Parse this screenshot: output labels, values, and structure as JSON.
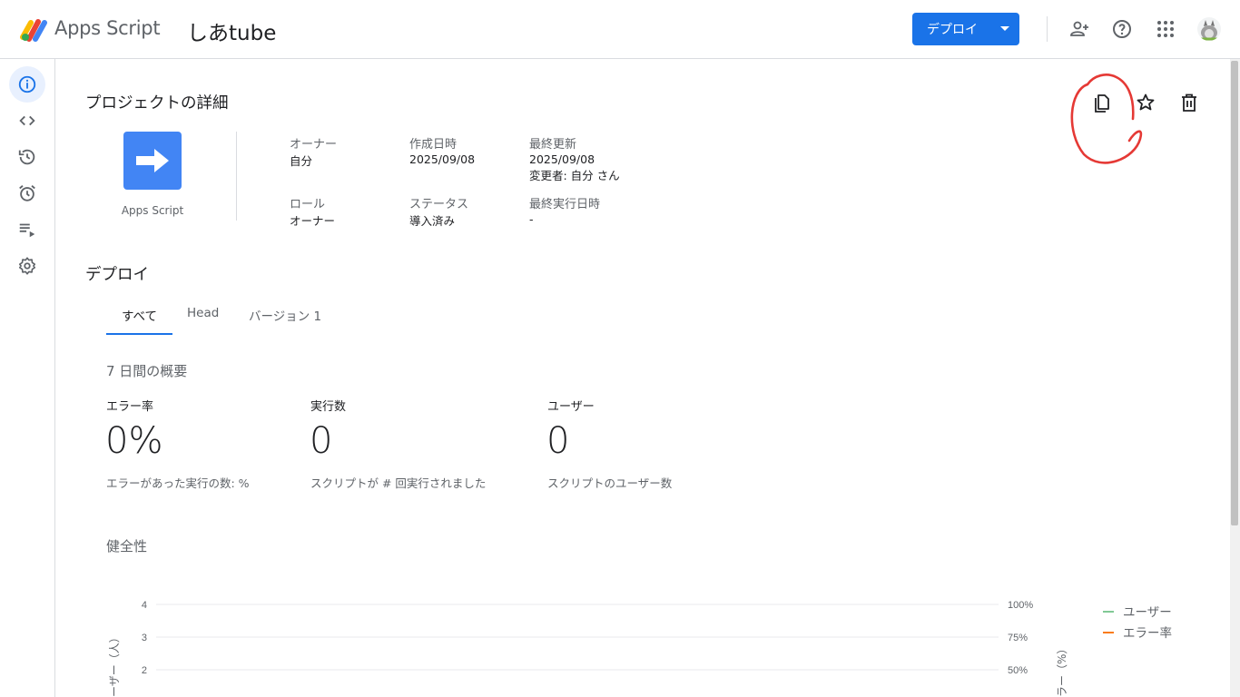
{
  "header": {
    "app_name": "Apps Script",
    "project_title": "しあtube",
    "deploy_button": "デプロイ",
    "icons": [
      "add-user-icon",
      "help-icon",
      "apps-grid-icon",
      "avatar"
    ]
  },
  "sidebar": {
    "items": [
      {
        "name": "overview",
        "icon": "info-icon",
        "active": true
      },
      {
        "name": "editor",
        "icon": "code-icon"
      },
      {
        "name": "history",
        "icon": "history-icon"
      },
      {
        "name": "triggers",
        "icon": "alarm-icon"
      },
      {
        "name": "executions",
        "icon": "playlist-icon"
      },
      {
        "name": "settings",
        "icon": "gear-icon"
      }
    ]
  },
  "project_details": {
    "title": "プロジェクトの詳細",
    "icon_label": "Apps Script",
    "owner_label": "オーナー",
    "owner_value": "自分",
    "created_label": "作成日時",
    "created_value": "2025/09/08",
    "updated_label": "最終更新",
    "updated_value": "2025/09/08",
    "updated_by": "変更者: 自分 さん",
    "role_label": "ロール",
    "role_value": "オーナー",
    "status_label": "ステータス",
    "status_value": "導入済み",
    "last_run_label": "最終実行日時",
    "last_run_value": "-",
    "actions": [
      "copy-icon",
      "star-icon",
      "delete-icon"
    ]
  },
  "deploy": {
    "title": "デプロイ",
    "tabs": [
      {
        "label": "すべて",
        "active": true
      },
      {
        "label": "Head"
      },
      {
        "label": "バージョン 1"
      }
    ]
  },
  "summary": {
    "title": "7 日間の概要",
    "stats": [
      {
        "label": "エラー率",
        "value": "0%",
        "desc": "エラーがあった実行の数: %"
      },
      {
        "label": "実行数",
        "value": "0",
        "desc": "スクリプトが # 回実行されました"
      },
      {
        "label": "ユーザー",
        "value": "0",
        "desc": "スクリプトのユーザー数"
      }
    ]
  },
  "health": {
    "title": "健全性"
  },
  "chart_data": {
    "type": "line",
    "title": "",
    "ylabel_left": "ユーザー（人）",
    "ylabel_right": "エラー（%）",
    "left_ticks": [
      "4",
      "3",
      "2"
    ],
    "right_ticks": [
      "100%",
      "75%",
      "50%"
    ],
    "ylim_left": [
      0,
      4
    ],
    "ylim_right": [
      0,
      100
    ],
    "legend_position": "top-right",
    "series": [
      {
        "name": "ユーザー",
        "color": "#81c995",
        "values": []
      },
      {
        "name": "エラー率",
        "color": "#fa7b17",
        "values": []
      }
    ]
  },
  "colors": {
    "accent": "#1a73e8",
    "annotation": "#e53935"
  }
}
